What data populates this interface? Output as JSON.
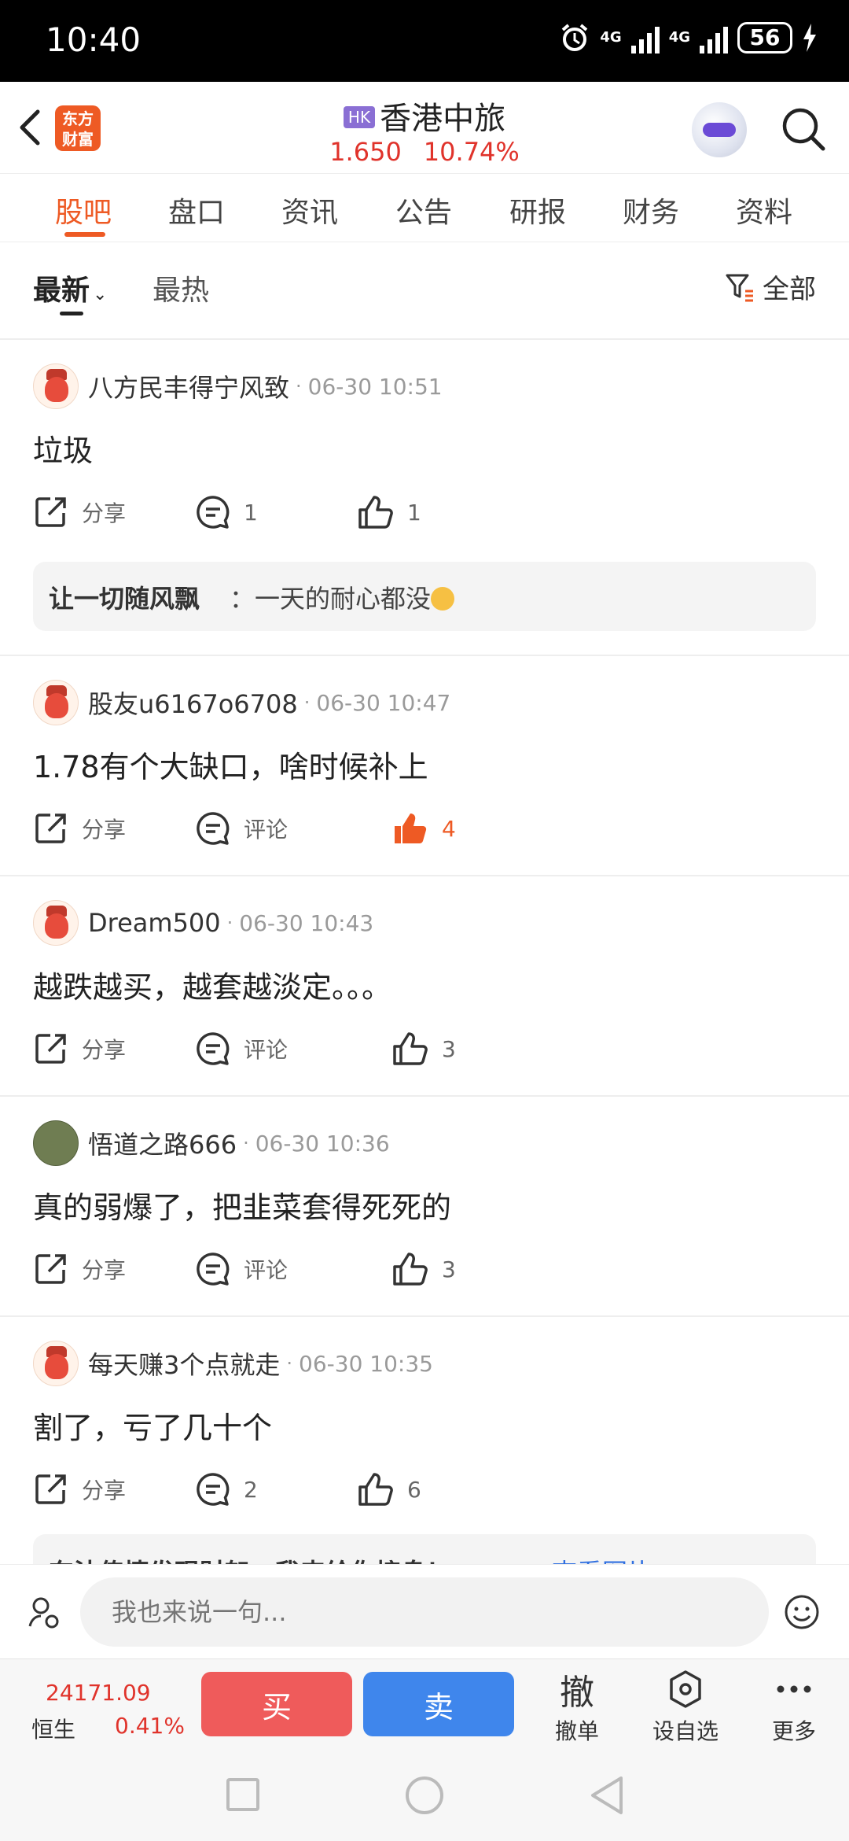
{
  "status_bar": {
    "time": "10:40",
    "network": "4G",
    "battery": "56"
  },
  "header": {
    "logo_text": "东方财富",
    "market_badge": "HK",
    "stock_name": "香港中旅",
    "price": "1.650",
    "change_pct": "10.74%"
  },
  "tabs": [
    "股吧",
    "盘口",
    "资讯",
    "公告",
    "研报",
    "财务",
    "资料"
  ],
  "sort": {
    "latest": "最新",
    "hot": "最热",
    "filter": "全部"
  },
  "actions": {
    "share": "分享",
    "comment": "评论"
  },
  "posts": [
    {
      "user": "八方民丰得宁风致",
      "time": "06-30 10:51",
      "content": "垃圾",
      "comments": "1",
      "likes": "1",
      "reply": {
        "user": "让一切随风飘",
        "text": "：一天的耐心都没"
      }
    },
    {
      "user": "股友u6167o6708",
      "time": "06-30 10:47",
      "content": "1.78有个大缺口，啥时候补上",
      "comments": "评论",
      "likes": "4"
    },
    {
      "user": "Dream500",
      "time": "06-30 10:43",
      "content": "越跌越买，越套越淡定。。。",
      "comments": "评论",
      "likes": "3"
    },
    {
      "user": "悟道之路666",
      "time": "06-30 10:36",
      "content": "真的弱爆了，把韭菜套得死死的",
      "comments": "评论",
      "likes": "3"
    },
    {
      "user": "每天赚3个点就走",
      "time": "06-30 10:35",
      "content": "割了，亏了几十个",
      "comments": "2",
      "likes": "6"
    }
  ],
  "promo": {
    "text": "东法传情发现财恕，我来给你接息！",
    "link": "查看图片"
  },
  "comment_input": {
    "placeholder": "我也来说一句..."
  },
  "trade_bar": {
    "index_value": "24171.09",
    "index_name": "恒生",
    "index_change": "0.41%",
    "buy": "买",
    "sell": "卖",
    "cancel_icon": "撤",
    "cancel": "撤单",
    "watch": "设自选",
    "more": "更多"
  },
  "colors": {
    "accent": "#ee5a24",
    "up": "#e0332b",
    "buy": "#ef5b5b",
    "sell": "#3f86ec"
  }
}
